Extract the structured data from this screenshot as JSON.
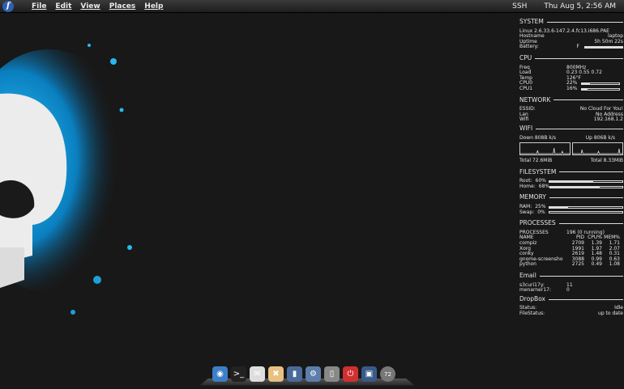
{
  "panel": {
    "menu": [
      "File",
      "Edit",
      "View",
      "Places",
      "Help"
    ],
    "ssh": "SSH",
    "clock": "Thu Aug  5,  2:56 AM",
    "logo_glyph": "f"
  },
  "conky": {
    "system": {
      "title": "SYSTEM",
      "kernel": "Linux 2.6.33.6-147.2.4.fc13.i686.PAE",
      "hostname_label": "Hostname",
      "hostname": "laptop",
      "uptime_label": "Uptime",
      "uptime": "5h 50m 22s",
      "battery_label": "Battery:",
      "battery_status": "F",
      "battery_level": 1.0
    },
    "cpu": {
      "title": "CPU",
      "freq_label": "Freq",
      "freq": "800MHz",
      "load_label": "Load",
      "load": "0.23 0.55 0.72",
      "temp_label": "Temp",
      "temp": "126°F",
      "cpu0_label": "CPU0",
      "cpu0": "22%",
      "cpu0_level": 0.22,
      "cpu1_label": "CPU1",
      "cpu1": "16%",
      "cpu1_level": 0.16
    },
    "network": {
      "title": "NETWORK",
      "essid_label": "ESSID:",
      "essid": "No Cloud For You!",
      "lan_label": "Lan",
      "lan": "No Address",
      "wifi_label": "Wifi",
      "wifi": "192.168.1.2"
    },
    "wifi": {
      "title": "WIFI",
      "down": "Down 808B   k/s",
      "up": "Up 806B   k/s",
      "total_down": "Total 72.6MiB",
      "total_up": "Total 8.33MiB"
    },
    "filesystem": {
      "title": "FILESYSTEM",
      "root_label": "Root:",
      "root": "60%",
      "root_level": 0.6,
      "home_label": "Home:",
      "home": "68%",
      "home_level": 0.68
    },
    "memory": {
      "title": "MEMORY",
      "ram_label": "RAM:",
      "ram": "25%",
      "ram_level": 0.25,
      "swap_label": "Swap:",
      "swap": "0%",
      "swap_level": 0.0
    },
    "processes": {
      "title": "PROCESSES",
      "count_label": "PROCESSES",
      "count": "196 (0 running)",
      "headers": [
        "NAME",
        "PID",
        "CPU%",
        "MEM%"
      ],
      "rows": [
        [
          "compiz",
          "2709",
          "1.39",
          "1.71"
        ],
        [
          "Xorg",
          "1991",
          "1.97",
          "2.07"
        ],
        [
          "conky",
          "2619",
          "1.48",
          "0.31"
        ],
        [
          "gnome-screensho",
          "3088",
          "0.99",
          "0.63"
        ],
        [
          "python",
          "2725",
          "0.49",
          "1.08"
        ]
      ]
    },
    "email": {
      "title": "Email",
      "acct1": "s3curi17y:",
      "acct1_count": "11",
      "acct2": "menarner17:",
      "acct2_count": "0"
    },
    "dropbox": {
      "title": "DropBox",
      "status_label": "Status:",
      "status": "Idle",
      "filestatus_label": "FileStatus:",
      "filestatus": "up to date"
    }
  },
  "dock": {
    "icons": [
      {
        "name": "chromium-icon",
        "color": "#3d7ec9",
        "glyph": "◉"
      },
      {
        "name": "terminal-icon",
        "color": "#222222",
        "glyph": ">_"
      },
      {
        "name": "mail-icon",
        "color": "#dddddd",
        "glyph": "✉"
      },
      {
        "name": "pidgin-icon",
        "color": "#e8c080",
        "glyph": "✖"
      },
      {
        "name": "downloads-icon",
        "color": "#4a6a9a",
        "glyph": "▮"
      },
      {
        "name": "system-settings-icon",
        "color": "#5b7faa",
        "glyph": "⚙"
      },
      {
        "name": "trash-icon",
        "color": "#888888",
        "glyph": "▯"
      },
      {
        "name": "shutdown-icon",
        "color": "#d03030",
        "glyph": "⏻"
      },
      {
        "name": "network-icon",
        "color": "#3a5a8a",
        "glyph": "▣"
      },
      {
        "name": "weather-icon",
        "color": "#777777",
        "glyph": "●"
      }
    ],
    "weather_temp": "72"
  }
}
